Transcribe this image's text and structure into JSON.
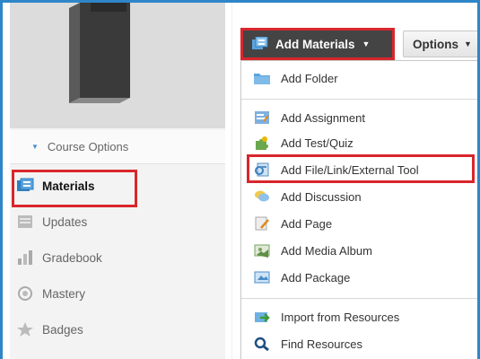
{
  "sidebar": {
    "course_options": "Course Options",
    "items": [
      {
        "label": "Materials",
        "icon": "materials-icon",
        "active": true
      },
      {
        "label": "Updates",
        "icon": "updates-icon",
        "active": false
      },
      {
        "label": "Gradebook",
        "icon": "gradebook-icon",
        "active": false
      },
      {
        "label": "Mastery",
        "icon": "mastery-icon",
        "active": false
      },
      {
        "label": "Badges",
        "icon": "badges-icon",
        "active": false
      }
    ]
  },
  "toolbar": {
    "add_materials_label": "Add Materials",
    "options_label": "Options"
  },
  "menu": {
    "items": [
      {
        "label": "Add Folder",
        "icon": "folder-icon"
      },
      {
        "label": "Add Assignment",
        "icon": "assignment-icon"
      },
      {
        "label": "Add Test/Quiz",
        "icon": "puzzle-icon"
      },
      {
        "label": "Add File/Link/External Tool",
        "icon": "file-link-icon"
      },
      {
        "label": "Add Discussion",
        "icon": "discussion-icon"
      },
      {
        "label": "Add Page",
        "icon": "page-icon"
      },
      {
        "label": "Add Media Album",
        "icon": "media-album-icon"
      },
      {
        "label": "Add Package",
        "icon": "package-icon"
      },
      {
        "label": "Import from Resources",
        "icon": "import-icon"
      },
      {
        "label": "Find Resources",
        "icon": "search-icon"
      }
    ]
  },
  "colors": {
    "highlight": "#d9262c",
    "frame": "#2e86c8",
    "button_dark": "#444444"
  }
}
